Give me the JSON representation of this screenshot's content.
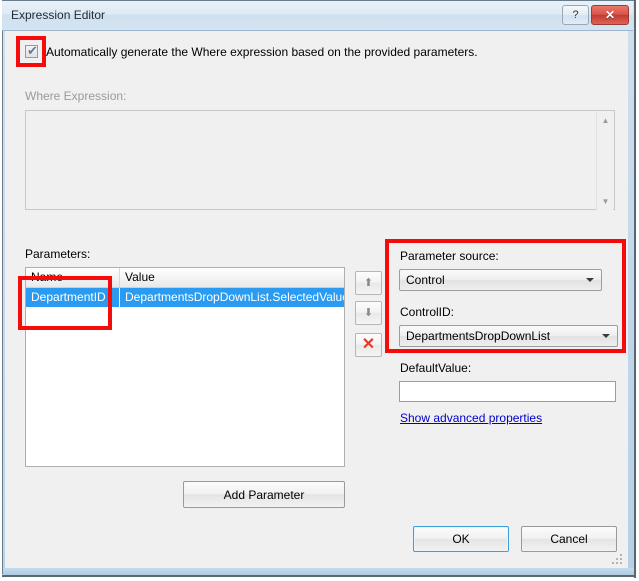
{
  "window": {
    "title": "Expression Editor",
    "help_button": "?",
    "close_button": "✕"
  },
  "auto_generate": {
    "checked": true,
    "check_glyph": "✔",
    "label": "Automatically generate the Where expression based on the provided parameters."
  },
  "where_expression": {
    "label": "Where Expression:",
    "value": "",
    "enabled": false,
    "scroll_up_glyph": "▲",
    "scroll_down_glyph": "▼"
  },
  "parameters": {
    "label": "Parameters:",
    "columns": [
      "Name",
      "Value"
    ],
    "rows": [
      {
        "name": "DepartmentID",
        "value": "DepartmentsDropDownList.SelectedValue",
        "selected": true
      }
    ],
    "move_up_glyph": "⬆",
    "move_down_glyph": "⬇",
    "delete_glyph": "✕",
    "add_button": "Add Parameter"
  },
  "parameter_source": {
    "source_label": "Parameter source:",
    "source_value": "Control",
    "controlid_label": "ControlID:",
    "controlid_value": "DepartmentsDropDownList",
    "defaultvalue_label": "DefaultValue:",
    "defaultvalue_value": "",
    "advanced_link": "Show advanced properties"
  },
  "footer": {
    "ok": "OK",
    "cancel": "Cancel"
  },
  "colors": {
    "accent_selection": "#2a9bf0",
    "annotation_red": "#f60b0b",
    "link_blue": "#0000cc",
    "close_red": "#d9534a"
  }
}
